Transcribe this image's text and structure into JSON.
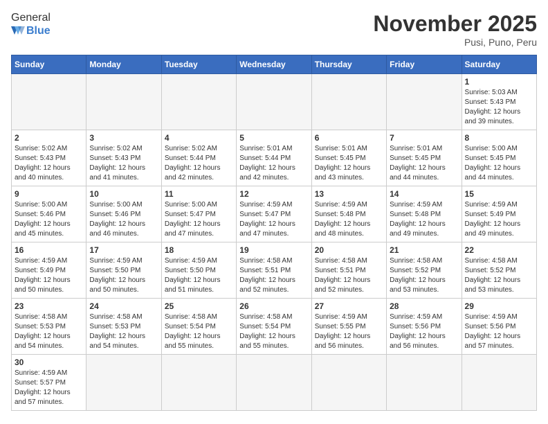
{
  "header": {
    "logo_general": "General",
    "logo_blue": "Blue",
    "month_title": "November 2025",
    "subtitle": "Pusi, Puno, Peru"
  },
  "days_of_week": [
    "Sunday",
    "Monday",
    "Tuesday",
    "Wednesday",
    "Thursday",
    "Friday",
    "Saturday"
  ],
  "weeks": [
    [
      {
        "day": "",
        "info": ""
      },
      {
        "day": "",
        "info": ""
      },
      {
        "day": "",
        "info": ""
      },
      {
        "day": "",
        "info": ""
      },
      {
        "day": "",
        "info": ""
      },
      {
        "day": "",
        "info": ""
      },
      {
        "day": "1",
        "info": "Sunrise: 5:03 AM\nSunset: 5:43 PM\nDaylight: 12 hours and 39 minutes."
      }
    ],
    [
      {
        "day": "2",
        "info": "Sunrise: 5:02 AM\nSunset: 5:43 PM\nDaylight: 12 hours and 40 minutes."
      },
      {
        "day": "3",
        "info": "Sunrise: 5:02 AM\nSunset: 5:43 PM\nDaylight: 12 hours and 41 minutes."
      },
      {
        "day": "4",
        "info": "Sunrise: 5:02 AM\nSunset: 5:44 PM\nDaylight: 12 hours and 42 minutes."
      },
      {
        "day": "5",
        "info": "Sunrise: 5:01 AM\nSunset: 5:44 PM\nDaylight: 12 hours and 42 minutes."
      },
      {
        "day": "6",
        "info": "Sunrise: 5:01 AM\nSunset: 5:45 PM\nDaylight: 12 hours and 43 minutes."
      },
      {
        "day": "7",
        "info": "Sunrise: 5:01 AM\nSunset: 5:45 PM\nDaylight: 12 hours and 44 minutes."
      },
      {
        "day": "8",
        "info": "Sunrise: 5:00 AM\nSunset: 5:45 PM\nDaylight: 12 hours and 44 minutes."
      }
    ],
    [
      {
        "day": "9",
        "info": "Sunrise: 5:00 AM\nSunset: 5:46 PM\nDaylight: 12 hours and 45 minutes."
      },
      {
        "day": "10",
        "info": "Sunrise: 5:00 AM\nSunset: 5:46 PM\nDaylight: 12 hours and 46 minutes."
      },
      {
        "day": "11",
        "info": "Sunrise: 5:00 AM\nSunset: 5:47 PM\nDaylight: 12 hours and 47 minutes."
      },
      {
        "day": "12",
        "info": "Sunrise: 4:59 AM\nSunset: 5:47 PM\nDaylight: 12 hours and 47 minutes."
      },
      {
        "day": "13",
        "info": "Sunrise: 4:59 AM\nSunset: 5:48 PM\nDaylight: 12 hours and 48 minutes."
      },
      {
        "day": "14",
        "info": "Sunrise: 4:59 AM\nSunset: 5:48 PM\nDaylight: 12 hours and 49 minutes."
      },
      {
        "day": "15",
        "info": "Sunrise: 4:59 AM\nSunset: 5:49 PM\nDaylight: 12 hours and 49 minutes."
      }
    ],
    [
      {
        "day": "16",
        "info": "Sunrise: 4:59 AM\nSunset: 5:49 PM\nDaylight: 12 hours and 50 minutes."
      },
      {
        "day": "17",
        "info": "Sunrise: 4:59 AM\nSunset: 5:50 PM\nDaylight: 12 hours and 50 minutes."
      },
      {
        "day": "18",
        "info": "Sunrise: 4:59 AM\nSunset: 5:50 PM\nDaylight: 12 hours and 51 minutes."
      },
      {
        "day": "19",
        "info": "Sunrise: 4:58 AM\nSunset: 5:51 PM\nDaylight: 12 hours and 52 minutes."
      },
      {
        "day": "20",
        "info": "Sunrise: 4:58 AM\nSunset: 5:51 PM\nDaylight: 12 hours and 52 minutes."
      },
      {
        "day": "21",
        "info": "Sunrise: 4:58 AM\nSunset: 5:52 PM\nDaylight: 12 hours and 53 minutes."
      },
      {
        "day": "22",
        "info": "Sunrise: 4:58 AM\nSunset: 5:52 PM\nDaylight: 12 hours and 53 minutes."
      }
    ],
    [
      {
        "day": "23",
        "info": "Sunrise: 4:58 AM\nSunset: 5:53 PM\nDaylight: 12 hours and 54 minutes."
      },
      {
        "day": "24",
        "info": "Sunrise: 4:58 AM\nSunset: 5:53 PM\nDaylight: 12 hours and 54 minutes."
      },
      {
        "day": "25",
        "info": "Sunrise: 4:58 AM\nSunset: 5:54 PM\nDaylight: 12 hours and 55 minutes."
      },
      {
        "day": "26",
        "info": "Sunrise: 4:58 AM\nSunset: 5:54 PM\nDaylight: 12 hours and 55 minutes."
      },
      {
        "day": "27",
        "info": "Sunrise: 4:59 AM\nSunset: 5:55 PM\nDaylight: 12 hours and 56 minutes."
      },
      {
        "day": "28",
        "info": "Sunrise: 4:59 AM\nSunset: 5:56 PM\nDaylight: 12 hours and 56 minutes."
      },
      {
        "day": "29",
        "info": "Sunrise: 4:59 AM\nSunset: 5:56 PM\nDaylight: 12 hours and 57 minutes."
      }
    ],
    [
      {
        "day": "30",
        "info": "Sunrise: 4:59 AM\nSunset: 5:57 PM\nDaylight: 12 hours and 57 minutes."
      },
      {
        "day": "",
        "info": ""
      },
      {
        "day": "",
        "info": ""
      },
      {
        "day": "",
        "info": ""
      },
      {
        "day": "",
        "info": ""
      },
      {
        "day": "",
        "info": ""
      },
      {
        "day": "",
        "info": ""
      }
    ]
  ]
}
